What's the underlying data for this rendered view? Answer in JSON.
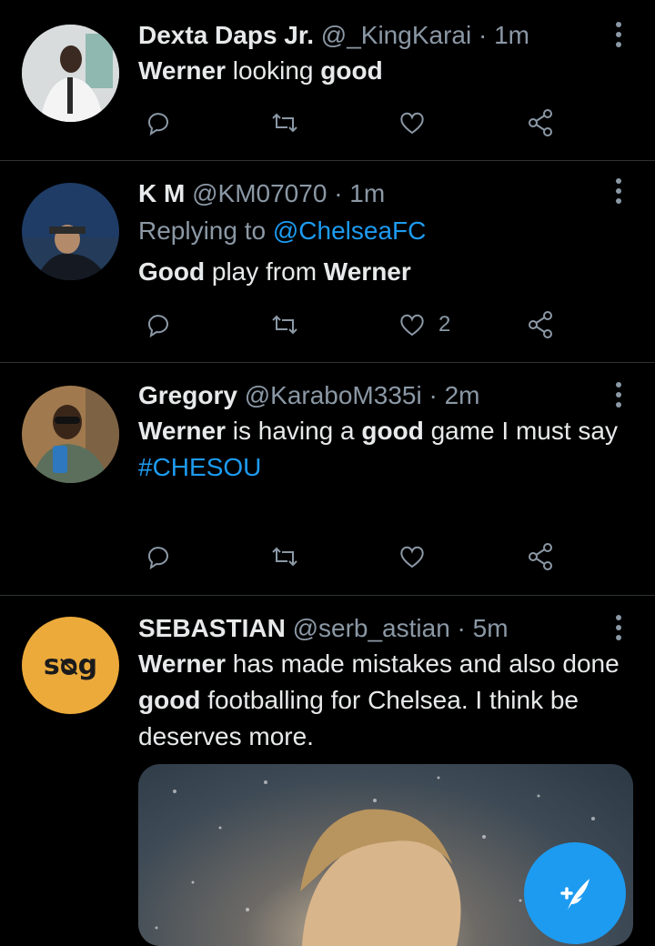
{
  "tweets": [
    {
      "name": "Dexta Daps Jr.",
      "handle": "@_KingKarai",
      "sep": "·",
      "time": "1m",
      "text_parts": [
        {
          "t": "Werner",
          "b": true
        },
        {
          "t": " looking ",
          "b": false
        },
        {
          "t": "good",
          "b": true
        }
      ],
      "likes": ""
    },
    {
      "name": "K M",
      "handle": "@KM07070",
      "sep": "·",
      "time": "1m",
      "replying_prefix": "Replying to ",
      "replying_to": "@ChelseaFC",
      "text_parts": [
        {
          "t": "Good",
          "b": true
        },
        {
          "t": " play from ",
          "b": false
        },
        {
          "t": "Werner",
          "b": true
        }
      ],
      "likes": "2"
    },
    {
      "name": "Gregory",
      "handle": "@KaraboM335i",
      "sep": "·",
      "time": "2m",
      "text_parts": [
        {
          "t": "Werner",
          "b": true
        },
        {
          "t": " is having a ",
          "b": false
        },
        {
          "t": "good",
          "b": true
        },
        {
          "t": " game I must say",
          "b": false
        }
      ],
      "hashtag": "#CHESOU",
      "likes": ""
    },
    {
      "name": "SEBASTIAN",
      "handle": "@serb_astian",
      "sep": "·",
      "time": "5m",
      "avatar_text": "sᴓg",
      "text_parts": [
        {
          "t": "Werner",
          "b": true
        },
        {
          "t": " has made mistakes and also done ",
          "b": false
        },
        {
          "t": "good",
          "b": true
        },
        {
          "t": " footballing for Chelsea. I think be deserves more.",
          "b": false
        }
      ]
    }
  ],
  "colors": {
    "accent": "#1d9bf0",
    "secondary_text": "#8b98a5",
    "background": "#000000",
    "divider": "#2f3336"
  },
  "icons": [
    "reply-icon",
    "retweet-icon",
    "like-icon",
    "share-icon",
    "more-icon",
    "compose-icon"
  ]
}
